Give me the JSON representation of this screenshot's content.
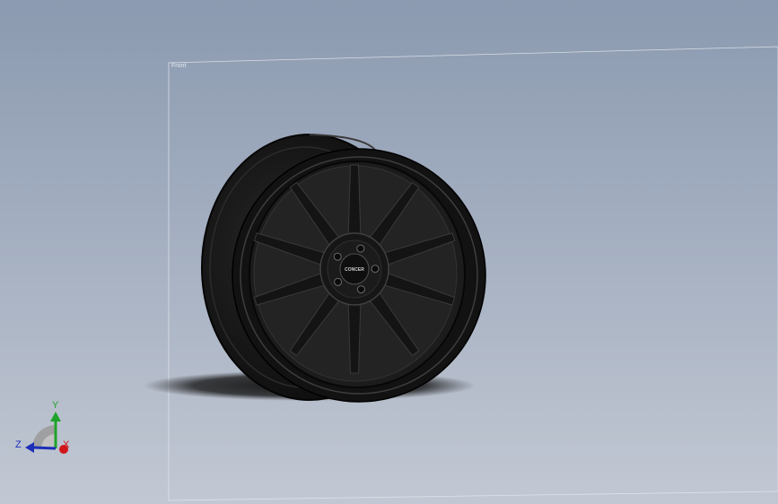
{
  "viewport": {
    "plane_label": "Front",
    "hub_logo_text": "CONCER"
  },
  "triad": {
    "x_label": "X",
    "y_label": "Y",
    "z_label": "Z",
    "x_color": "#d0151b",
    "y_color": "#1fa32a",
    "z_color": "#1c2fb8"
  },
  "wheel": {
    "spoke_count": 10,
    "lug_count": 5,
    "finish_color": "#151515"
  }
}
